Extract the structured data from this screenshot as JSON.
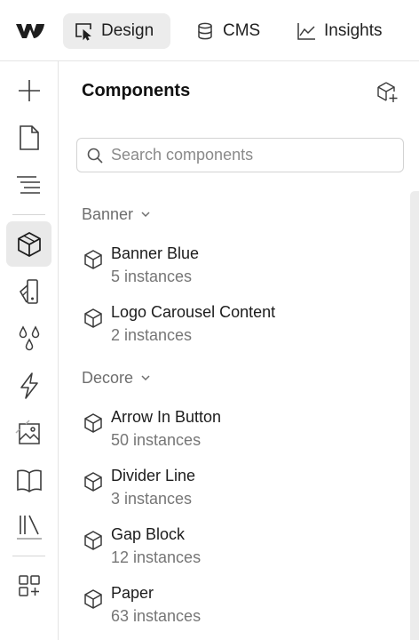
{
  "topbar": {
    "logo_icon": "webflow-logo",
    "tabs": [
      {
        "label": "Design",
        "icon": "cursor-frame-icon",
        "active": true
      },
      {
        "label": "CMS",
        "icon": "database-icon",
        "active": false
      },
      {
        "label": "Insights",
        "icon": "chart-line-icon",
        "active": false
      }
    ]
  },
  "rail": {
    "items": [
      {
        "icon": "plus-icon",
        "active": false
      },
      {
        "icon": "page-icon",
        "active": false
      },
      {
        "icon": "navigator-icon",
        "active": false
      },
      {
        "icon": "component-cube-icon",
        "active": true
      },
      {
        "icon": "style-swatch-icon",
        "active": false
      },
      {
        "icon": "variables-drops-icon",
        "active": false
      },
      {
        "icon": "interactions-bolt-icon",
        "active": false
      },
      {
        "icon": "assets-image-icon",
        "active": false
      },
      {
        "icon": "library-book-icon",
        "active": false
      },
      {
        "icon": "stack-lines-icon",
        "active": false
      },
      {
        "icon": "apps-grid-icon",
        "active": false
      }
    ]
  },
  "panel": {
    "title": "Components",
    "add_icon": "add-component-icon",
    "search": {
      "placeholder": "Search components",
      "value": ""
    },
    "groups": [
      {
        "name": "Banner",
        "components": [
          {
            "name": "Banner Blue",
            "count": "5 instances"
          },
          {
            "name": "Logo Carousel Content",
            "count": "2 instances"
          }
        ]
      },
      {
        "name": "Decore",
        "components": [
          {
            "name": "Arrow In Button",
            "count": "50 instances"
          },
          {
            "name": "Divider Line",
            "count": "3 instances"
          },
          {
            "name": "Gap Block",
            "count": "12 instances"
          },
          {
            "name": "Paper",
            "count": "63 instances"
          }
        ]
      }
    ]
  },
  "colors": {
    "active_bg": "#ececec",
    "border": "#e4e4e4",
    "muted_text": "#767676",
    "group_text": "#6e6e6e"
  }
}
